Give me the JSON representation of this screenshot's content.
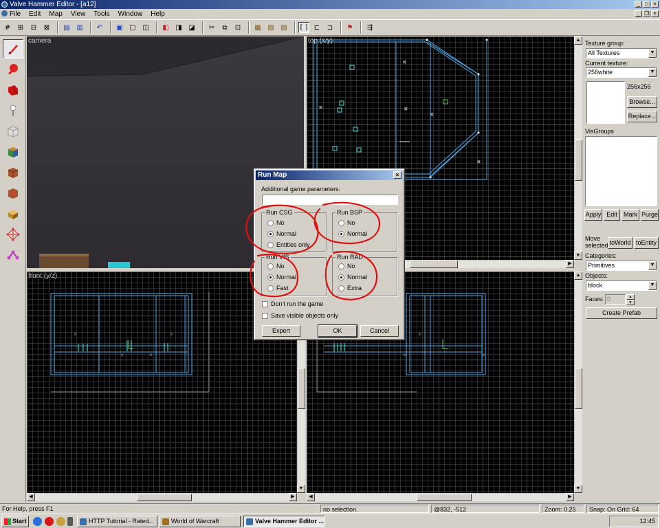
{
  "window": {
    "title": "Valve Hammer Editor - [a12]"
  },
  "menu": [
    "File",
    "Edit",
    "Map",
    "View",
    "Tools",
    "Window",
    "Help"
  ],
  "viewports": {
    "camera": "camera",
    "top": "top (x/y)",
    "front": "front (y/z)"
  },
  "right_panel": {
    "texture_group_label": "Texture group:",
    "texture_group_value": "All Textures",
    "current_texture_label": "Current texture:",
    "current_texture_value": "256white",
    "texture_size": "256x256",
    "browse_button": "Browse...",
    "replace_button": "Replace...",
    "visgroup_label": "VisGroups",
    "apply_button": "Apply",
    "edit_button": "Edit",
    "mark_button": "Mark",
    "purge_button": "Purge",
    "move_selected_label": "Move selected:",
    "to_world_button": "toWorld",
    "to_entity_button": "toEntity",
    "categories_label": "Categories:",
    "categories_value": "Primitives",
    "objects_label": "Objects:",
    "objects_value": "block",
    "faces_label": "Faces:",
    "faces_value": "0",
    "create_prefab_button": "Create Prefab"
  },
  "dialog": {
    "title": "Run Map",
    "params_label": "Additional game parameters:",
    "params_value": "",
    "csg": {
      "title": "Run CSG",
      "options": [
        "No",
        "Normal",
        "Entities only"
      ],
      "selected": 1
    },
    "bsp": {
      "title": "Run BSP",
      "options": [
        "No",
        "Normal"
      ],
      "selected": 1
    },
    "vis": {
      "title": "Run VIS",
      "options": [
        "No",
        "Normal",
        "Fast"
      ],
      "selected": 1
    },
    "rad": {
      "title": "Run RAD",
      "options": [
        "No",
        "Normal",
        "Extra"
      ],
      "selected": 1
    },
    "dont_run_game": "Don't run the game",
    "save_visible_only": "Save visible objects only",
    "expert_button": "Expert",
    "ok_button": "OK",
    "cancel_button": "Cancel"
  },
  "status": {
    "help": "For Help, press F1",
    "selection": "no selection.",
    "coords": "@832, -512",
    "zoom": "Zoom: 0.25",
    "snap": "Snap: On Grid: 64"
  },
  "taskbar": {
    "start": "Start",
    "tasks": [
      "HTTP Tutorial - Rated...",
      "World of Warcraft",
      "Valve Hammer Editor ..."
    ],
    "clock": "12:45"
  },
  "colors": {
    "brush_blue": "#4aa6e8",
    "brush_cyan": "#4ee0d8",
    "annotation_red": "#e01010"
  }
}
